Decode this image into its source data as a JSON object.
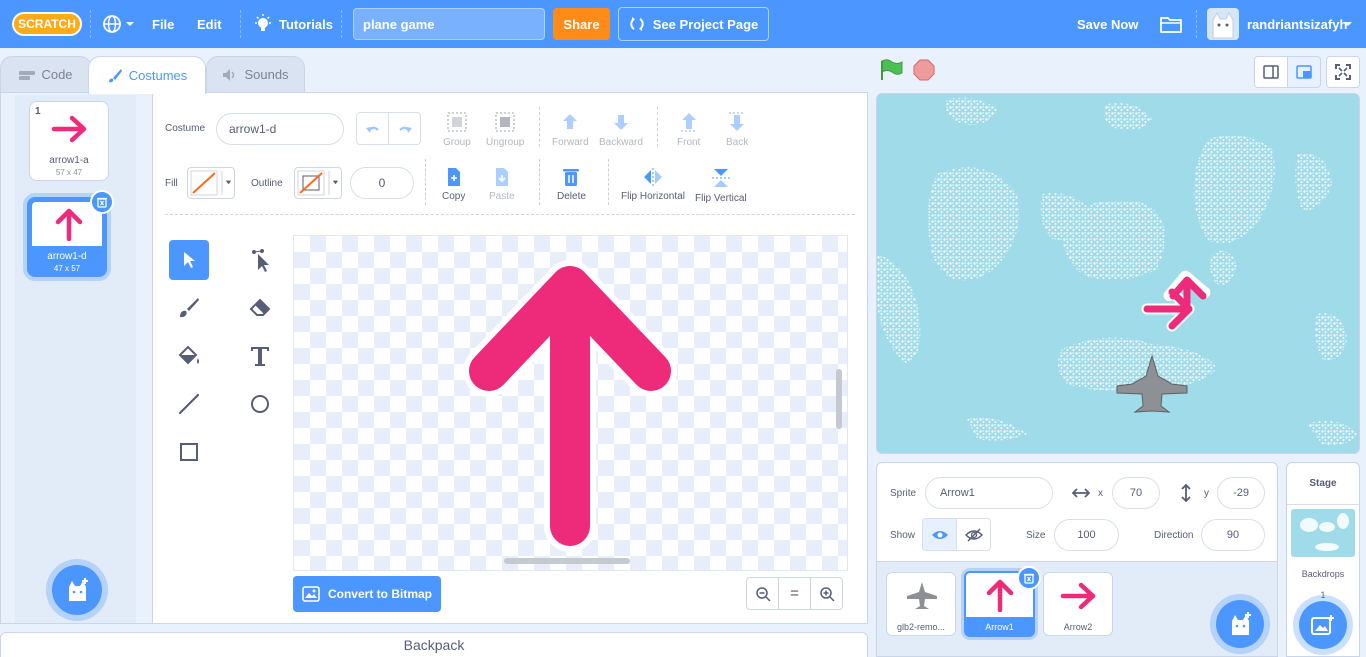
{
  "menubar": {
    "logo_text": "SCRATCH",
    "file": "File",
    "edit": "Edit",
    "tutorials": "Tutorials",
    "project_title": "plane game",
    "share": "Share",
    "see_project_page": "See Project Page",
    "save_now": "Save Now",
    "username": "randriantsizafyh"
  },
  "tabs": {
    "code": "Code",
    "costumes": "Costumes",
    "sounds": "Sounds"
  },
  "costumes": [
    {
      "number": "1",
      "name": "arrow1-a",
      "size": "57 x 47"
    },
    {
      "number": "2",
      "name": "arrow1-d",
      "size": "47 x 57"
    }
  ],
  "paint": {
    "costume_label": "Costume",
    "costume_name": "arrow1-d",
    "fill_label": "Fill",
    "outline_label": "Outline",
    "outline_width": "0",
    "group": "Group",
    "ungroup": "Ungroup",
    "forward": "Forward",
    "backward": "Backward",
    "front": "Front",
    "back": "Back",
    "copy": "Copy",
    "paste": "Paste",
    "delete": "Delete",
    "flip_horizontal": "Flip Horizontal",
    "flip_vertical": "Flip Vertical",
    "convert_to_bitmap": "Convert to Bitmap",
    "zoom_reset": "="
  },
  "backpack": "Backpack",
  "sprite_info": {
    "sprite_label": "Sprite",
    "sprite_name": "Arrow1",
    "x_label": "x",
    "x_value": "70",
    "y_label": "y",
    "y_value": "-29",
    "show_label": "Show",
    "size_label": "Size",
    "size_value": "100",
    "direction_label": "Direction",
    "direction_value": "90"
  },
  "sprites": [
    {
      "name": "glb2-remo..."
    },
    {
      "name": "Arrow1"
    },
    {
      "name": "Arrow2"
    }
  ],
  "stage_panel": {
    "title": "Stage",
    "backdrops_label": "Backdrops",
    "backdrops_count": "1"
  },
  "colors": {
    "accent": "#4c97ff",
    "share": "#ff8c1a",
    "arrow": "#ee2a7b",
    "sky": "#9fdbe8"
  },
  "icons": [
    "globe-icon",
    "tutorials-bulb-icon",
    "remix-icon",
    "folder-icon",
    "green-flag-icon",
    "stop-icon",
    "select-tool-icon",
    "reshape-tool-icon",
    "brush-tool-icon",
    "eraser-tool-icon",
    "fill-tool-icon",
    "text-tool-icon",
    "line-tool-icon",
    "circle-tool-icon",
    "rect-tool-icon"
  ]
}
